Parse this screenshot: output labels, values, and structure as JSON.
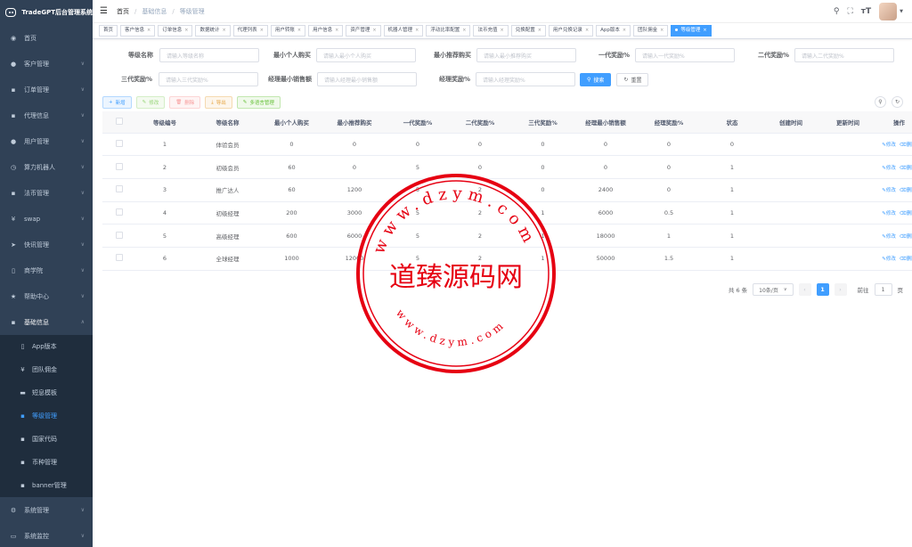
{
  "brand": {
    "title": "TradeGPT后台管理系统"
  },
  "sidebar": {
    "items": [
      {
        "label": "首页",
        "icon": "dashboard-icon"
      },
      {
        "label": "客户管理",
        "icon": "user-icon"
      },
      {
        "label": "订单管理",
        "icon": "document-icon"
      },
      {
        "label": "代理信息",
        "icon": "document-icon"
      },
      {
        "label": "用户管理",
        "icon": "user-icon"
      },
      {
        "label": "算力机器人",
        "icon": "clock-icon"
      },
      {
        "label": "法币管理",
        "icon": "document-icon"
      },
      {
        "label": "swap",
        "icon": "yen-icon"
      },
      {
        "label": "快讯管理",
        "icon": "send-icon"
      },
      {
        "label": "商学院",
        "icon": "book-icon"
      },
      {
        "label": "帮助中心",
        "icon": "star-icon"
      },
      {
        "label": "基础信息",
        "icon": "document-icon"
      }
    ],
    "subitems": [
      {
        "label": "App版本",
        "icon": "phone-icon"
      },
      {
        "label": "团队佣金",
        "icon": "yen-icon"
      },
      {
        "label": "短息模板",
        "icon": "message-icon"
      },
      {
        "label": "等级管理",
        "icon": "document-icon"
      },
      {
        "label": "国家代码",
        "icon": "document-icon"
      },
      {
        "label": "币种管理",
        "icon": "document-icon"
      },
      {
        "label": "banner管理",
        "icon": "document-icon"
      }
    ],
    "bottom": [
      {
        "label": "系统管理",
        "icon": "gear-icon"
      },
      {
        "label": "系统监控",
        "icon": "monitor-icon"
      }
    ]
  },
  "breadcrumb": {
    "home": "首页",
    "parent": "基础信息",
    "current": "等级管理"
  },
  "tags": [
    "首页",
    "客户信息",
    "订单信息",
    "数据统计",
    "代理列表",
    "用户转账",
    "用户信息",
    "资产管理",
    "机器人管理",
    "浮动比率配置",
    "法币充值",
    "兑换配置",
    "用户兑换记录",
    "App版本",
    "团队佣金",
    "等级管理"
  ],
  "search": {
    "level_name": {
      "label": "等级名称",
      "placeholder": "请输入等级名称"
    },
    "min_personal": {
      "label": "最小个人购买",
      "placeholder": "请输入最小个人购买"
    },
    "min_referral": {
      "label": "最小推荐购买",
      "placeholder": "请输入最小推荐购买"
    },
    "first_reward": {
      "label": "一代奖励%",
      "placeholder": "请输入一代奖励%"
    },
    "second_reward": {
      "label": "二代奖励%",
      "placeholder": "请输入二代奖励%"
    },
    "third_reward": {
      "label": "三代奖励%",
      "placeholder": "请输入三代奖励%"
    },
    "manager_min_sales": {
      "label": "经理最小销售额",
      "placeholder": "请输入经理最小销售额"
    },
    "manager_reward": {
      "label": "经理奖励%",
      "placeholder": "请输入经理奖励%"
    },
    "search_btn": "搜索",
    "reset_btn": "重置"
  },
  "toolbar": {
    "add": "新增",
    "edit": "修改",
    "delete": "删除",
    "export": "导出",
    "multilang": "多语言管理"
  },
  "table": {
    "headers": [
      "等级编号",
      "等级名称",
      "最小个人购买",
      "最小推荐购买",
      "一代奖励%",
      "二代奖励%",
      "三代奖励%",
      "经理最小销售额",
      "经理奖励%",
      "状态",
      "创建时间",
      "更新时间",
      "操作"
    ],
    "rows": [
      {
        "cells": [
          "1",
          "体验会员",
          "0",
          "0",
          "0",
          "0",
          "0",
          "0",
          "0",
          "0",
          "",
          ""
        ]
      },
      {
        "cells": [
          "2",
          "初级会员",
          "60",
          "0",
          "5",
          "0",
          "0",
          "0",
          "0",
          "1",
          "",
          ""
        ]
      },
      {
        "cells": [
          "3",
          "推广达人",
          "60",
          "1200",
          "5",
          "2",
          "0",
          "2400",
          "0",
          "1",
          "",
          ""
        ]
      },
      {
        "cells": [
          "4",
          "初级经理",
          "200",
          "3000",
          "5",
          "2",
          "1",
          "6000",
          "0.5",
          "1",
          "",
          ""
        ]
      },
      {
        "cells": [
          "5",
          "高级经理",
          "600",
          "6000",
          "5",
          "2",
          "1",
          "18000",
          "1",
          "1",
          "",
          ""
        ]
      },
      {
        "cells": [
          "6",
          "全球经理",
          "1000",
          "12000",
          "5",
          "2",
          "1",
          "50000",
          "1.5",
          "1",
          "",
          ""
        ]
      }
    ],
    "op_edit": "修改",
    "op_delete": "删除"
  },
  "pagination": {
    "total": "共 6 条",
    "page_size": "10条/页",
    "current": "1",
    "goto": "前往",
    "goto_value": "1",
    "page_suffix": "页"
  },
  "watermark": {
    "text": "道臻源码网",
    "url_top": "www.dzym.com",
    "url_bottom": "www.dzym.com"
  },
  "colors": {
    "sidebar_bg": "#304156",
    "submenu_bg": "#1f2d3d",
    "accent": "#409eff",
    "stamp": "#e60012"
  }
}
